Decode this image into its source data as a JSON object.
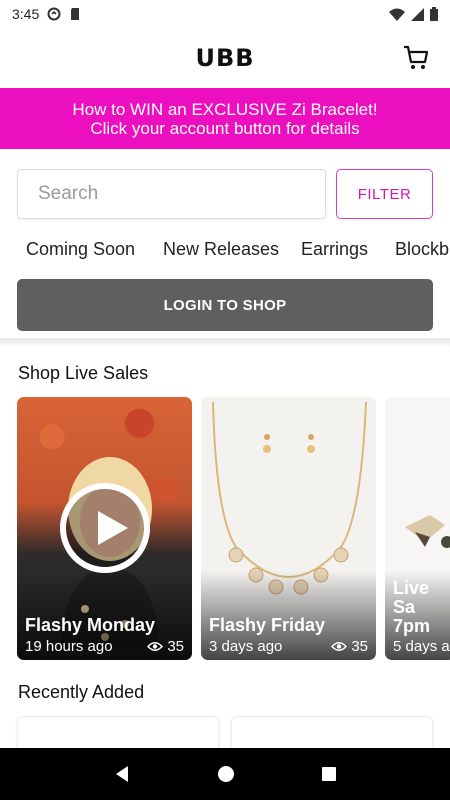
{
  "status": {
    "time": "3:45"
  },
  "app": {
    "title": "UBB"
  },
  "promo": {
    "line1": "How to WIN an EXCLUSIVE Zi Bracelet!",
    "line2": "Click your account button for details"
  },
  "search": {
    "placeholder": "Search",
    "value": ""
  },
  "filter_label": "FILTER",
  "categories": [
    "Coming Soon",
    "New Releases",
    "Earrings",
    "Blockb"
  ],
  "login_label": "LOGIN TO SHOP",
  "live_sales": {
    "title": "Shop Live Sales",
    "cards": [
      {
        "name": "Flashy Monday",
        "time": "19 hours ago",
        "views": "35"
      },
      {
        "name": "Flashy Friday",
        "time": "3 days ago",
        "views": "35"
      },
      {
        "name": "Live Sa",
        "name2": "7pm",
        "time": "5 days a",
        "views": ""
      }
    ]
  },
  "recently_added": {
    "title": "Recently Added"
  },
  "colors": {
    "accent": "#ec0fbf",
    "filter_border": "#e13cbf",
    "login_bg": "#5f5f5f"
  },
  "icons": [
    "wifi-icon",
    "signal-icon",
    "battery-icon",
    "cart-icon",
    "play-icon",
    "eye-icon",
    "back-icon",
    "home-icon",
    "recents-icon"
  ]
}
